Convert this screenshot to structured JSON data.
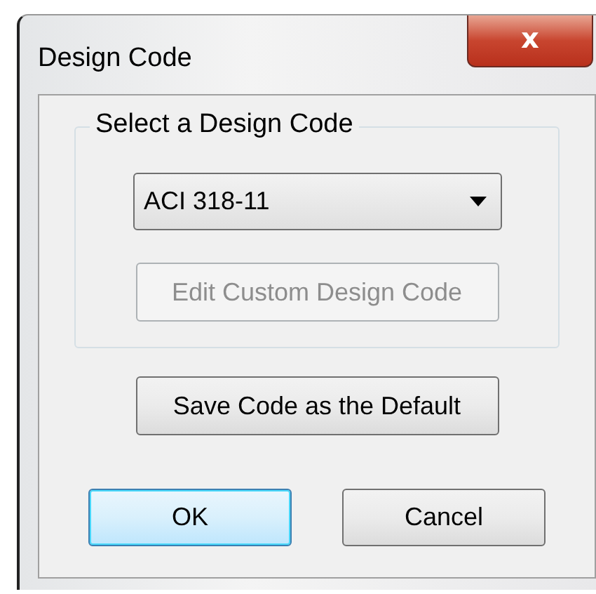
{
  "window": {
    "title": "Design Code",
    "close_label": "x"
  },
  "group": {
    "label": "Select a Design Code",
    "dropdown": {
      "value": "ACI 318-11"
    },
    "buttons": [
      {
        "label": "Edit Custom Design Code",
        "disabled": true
      }
    ]
  },
  "buttons": [
    {
      "label": "Save Code as the Default",
      "disabled": false,
      "default": false
    }
  ],
  "footer_buttons": [
    {
      "label": "OK",
      "disabled": false,
      "default": true
    },
    {
      "label": "Cancel",
      "disabled": false,
      "default": false
    }
  ]
}
